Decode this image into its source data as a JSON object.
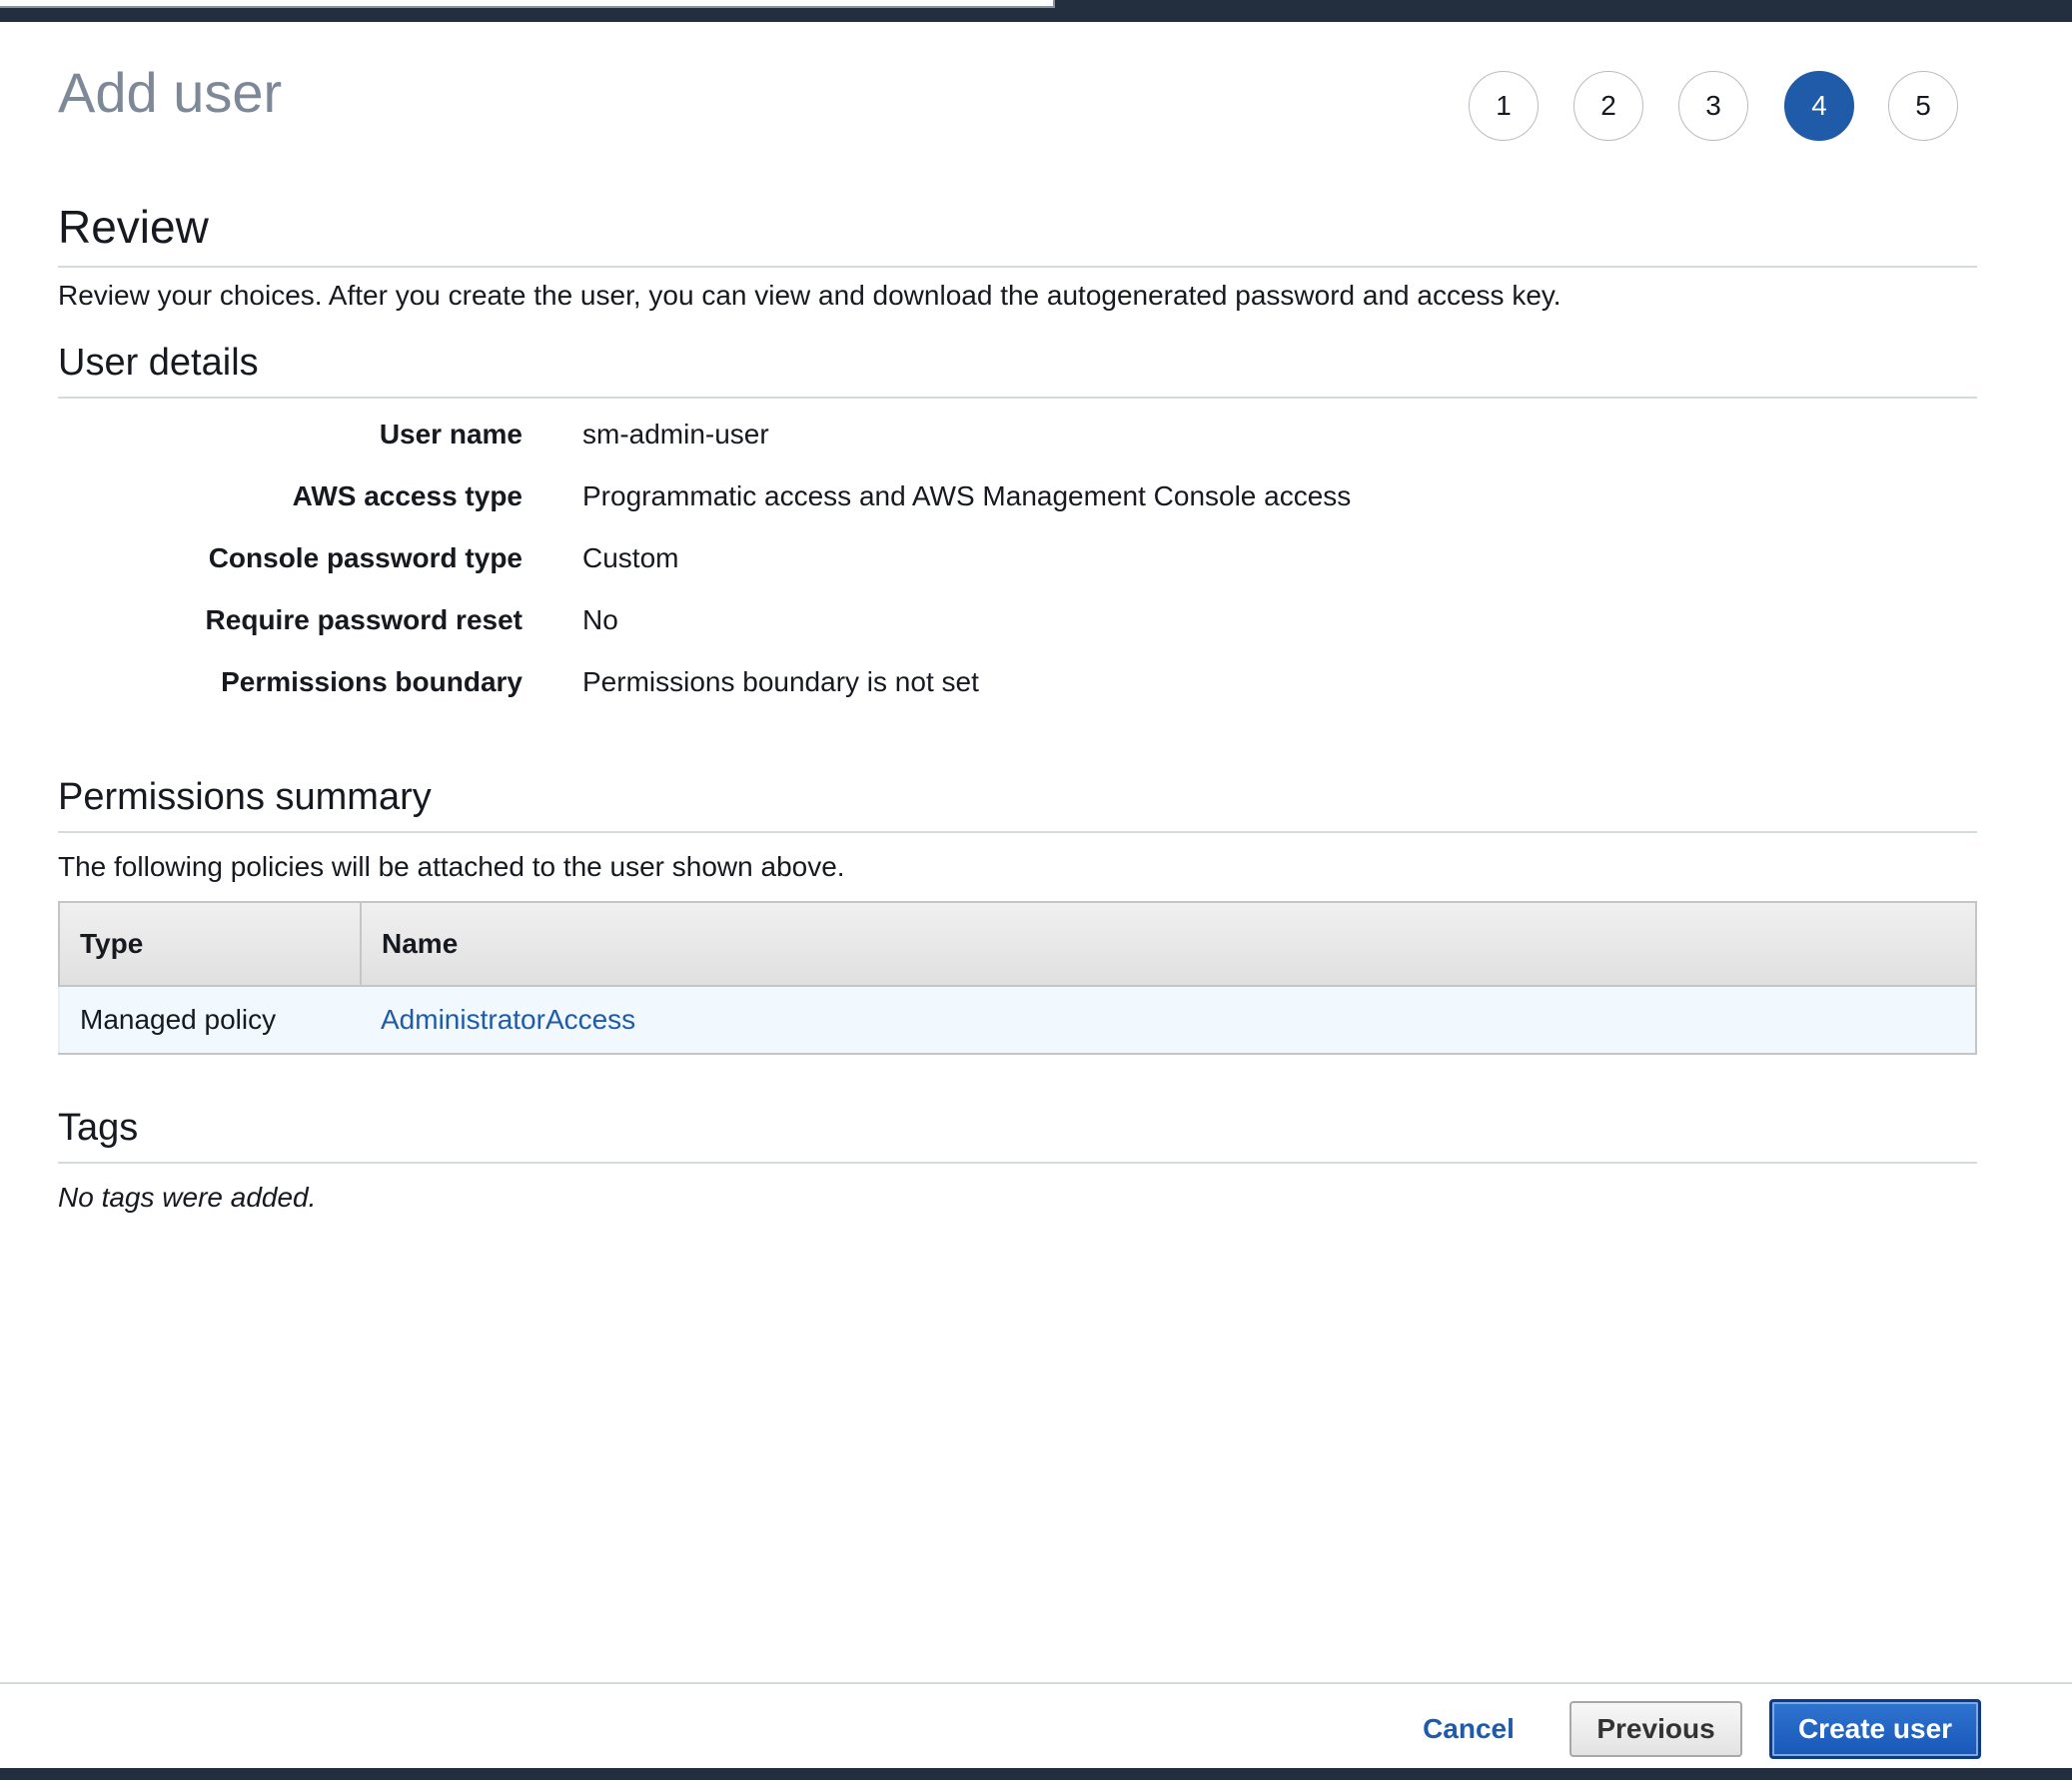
{
  "page": {
    "title": "Add user"
  },
  "stepper": {
    "steps": [
      "1",
      "2",
      "3",
      "4",
      "5"
    ],
    "active_step": 4
  },
  "review": {
    "title": "Review",
    "description": "Review your choices. After you create the user, you can view and download the autogenerated password and access key."
  },
  "user_details": {
    "title": "User details",
    "rows": [
      {
        "label": "User name",
        "value": "sm-admin-user"
      },
      {
        "label": "AWS access type",
        "value": "Programmatic access and AWS Management Console access"
      },
      {
        "label": "Console password type",
        "value": "Custom"
      },
      {
        "label": "Require password reset",
        "value": "No"
      },
      {
        "label": "Permissions boundary",
        "value": "Permissions boundary is not set"
      }
    ]
  },
  "permissions": {
    "title": "Permissions summary",
    "description": "The following policies will be attached to the user shown above.",
    "columns": [
      "Type",
      "Name"
    ],
    "rows": [
      {
        "type": "Managed policy",
        "name": "AdministratorAccess"
      }
    ]
  },
  "tags": {
    "title": "Tags",
    "empty_text": "No tags were added."
  },
  "footer": {
    "cancel_label": "Cancel",
    "previous_label": "Previous",
    "create_label": "Create user"
  },
  "colors": {
    "accent": "#1f5ba8",
    "header_bar": "#232f3e",
    "title_gray": "#7d8998"
  }
}
